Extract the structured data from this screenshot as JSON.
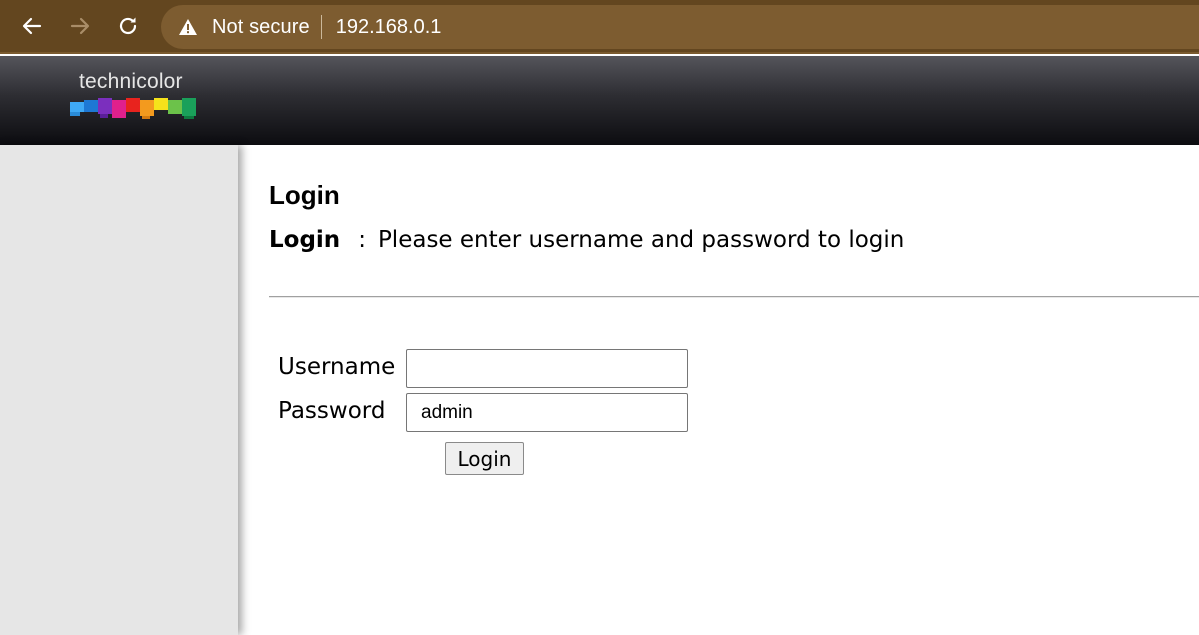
{
  "browser": {
    "security_label": "Not secure",
    "url": "192.168.0.1",
    "icons": {
      "back": "back-arrow-icon",
      "forward": "forward-arrow-icon",
      "reload": "reload-icon",
      "warning": "warning-icon"
    },
    "colors": {
      "toolbar": "#63461f",
      "omnibox": "#7d5c30"
    }
  },
  "header": {
    "logo_text": "technicolor",
    "logo_colors": [
      "#3fa9f5",
      "#1e78d4",
      "#7b2fbe",
      "#e0208c",
      "#e8231e",
      "#f39a1e",
      "#f5e21b",
      "#6cc24a",
      "#1aa05a"
    ]
  },
  "page": {
    "title": "Login",
    "subtitle_key": "Login",
    "subtitle_colon": ":",
    "subtitle_text": "Please enter username and password to login"
  },
  "form": {
    "username_label": "Username",
    "username_value": "",
    "password_label": "Password",
    "password_value": "admin",
    "submit_label": "Login"
  }
}
